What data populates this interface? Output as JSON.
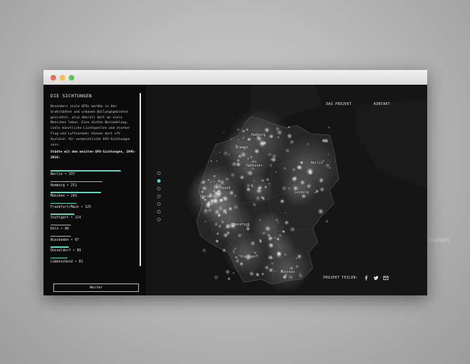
{
  "background": {
    "word": "ünchen"
  },
  "window": {
    "dots": [
      "#ec6a5e",
      "#f4bf4f",
      "#61c554"
    ]
  },
  "sidebar": {
    "title": "DIE SICHTUNGEN",
    "intro": "Besonders viele UFOs werden in den Großstädten und urbanen Ballungsgebieten gesichtet, also überall dort wo viele Menschen leben. Eine dichte Besiedelung, viele künstliche Lichtquellen und starker Flug-und Luftverkehr können dort oft Auslöser für vermeintliche UFO-Sichtungen sein.",
    "subtitle": "Städte mit den meisten UFO-Sichtungen, 1945-2016:",
    "bar_color": "#5fd6c4",
    "cities": [
      {
        "label": "Berlin • 337",
        "count": 337
      },
      {
        "label": "Hamburg • 251",
        "count": 251
      },
      {
        "label": "München • 243",
        "count": 243
      },
      {
        "label": "Frankfurt/Main • 125",
        "count": 125
      },
      {
        "label": "Stuttgart • 114",
        "count": 114
      },
      {
        "label": "Köln • 98",
        "count": 98
      },
      {
        "label": "Wiesbaden • 97",
        "count": 97
      },
      {
        "label": "Düsseldorf • 89",
        "count": 89
      },
      {
        "label": "Lüdenscheid • 81",
        "count": 81
      }
    ],
    "button": "Weiter"
  },
  "pager": {
    "count": 7,
    "active": 1
  },
  "nav": {
    "project": "DAS PROJEKT",
    "contact": "KONTAKT"
  },
  "share": {
    "label": "PROJEKT TEILEN:",
    "icons": [
      "facebook-icon",
      "twitter-icon",
      "mail-icon"
    ]
  },
  "map_labels": {
    "hamburg": "Hamburg",
    "bremen": "Bremen",
    "hannover": "Hannover",
    "berlin": "Berlin",
    "dortmund": "Dortmund",
    "duesseldorf": "Düsseldorf",
    "leipzig": "Leipzig",
    "frankfurt": "Frankfurt",
    "stuttgart": "Stuttgart",
    "muenchen": "München"
  }
}
